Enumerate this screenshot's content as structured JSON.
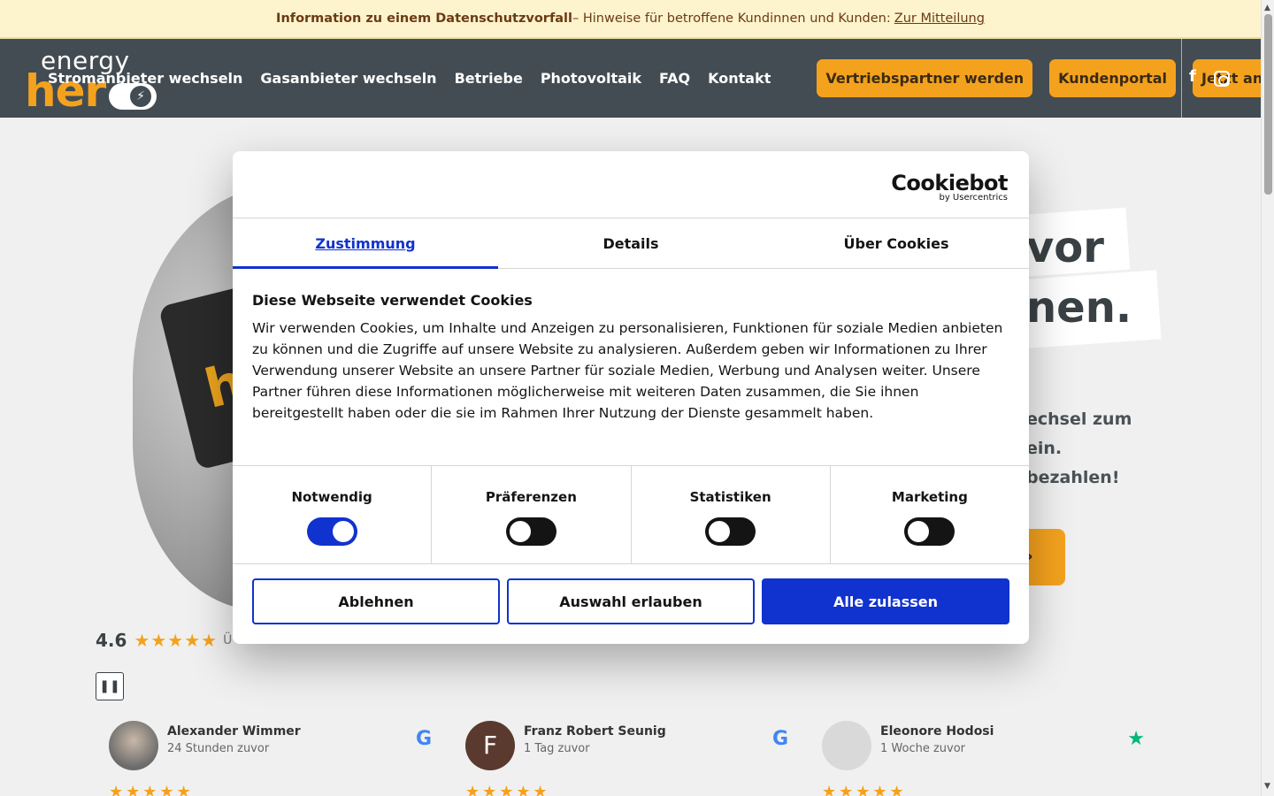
{
  "notice": {
    "bold": "Information zu einem Datenschutzvorfall",
    "text": " – Hinweise für betroffene Kundinnen und Kunden: ",
    "link": "Zur Mitteilung"
  },
  "logo": {
    "line1": "energy",
    "line2": "her",
    "icon": "lightning-icon",
    "glyph": "⚡"
  },
  "nav": {
    "links": [
      "Stromanbieter wechseln",
      "Gasanbieter wechseln",
      "Betriebe",
      "Photovoltaik",
      "FAQ",
      "Kontakt"
    ],
    "buttons": [
      "Vertriebspartner werden",
      "Kundenportal",
      "Jetzt anmelden!"
    ],
    "social": {
      "facebook": "f",
      "facebook_icon": "facebook-icon",
      "instagram_icon": "instagram-icon"
    }
  },
  "hero": {
    "title1": "vor",
    "title2": "nen.",
    "sub1": "echsel zum",
    "sub2": "ein.",
    "sub3": "bezahlen!",
    "cta_arrow": "›",
    "bulb_letter": "h"
  },
  "rating": {
    "value": "4.6",
    "stars": "★★★★★",
    "label": "Ü"
  },
  "pause": "❚❚",
  "reviews": [
    {
      "name": "Alexander Wimmer",
      "time": "24 Stunden zuvor",
      "source": "G",
      "stars": "★★★★★"
    },
    {
      "name": "Franz Robert Seunig",
      "time": "1 Tag zuvor",
      "source": "G",
      "initial": "F",
      "stars": "★★★★★"
    },
    {
      "name": "Eleonore Hodosi",
      "time": "1 Woche zuvor",
      "source": "★",
      "stars": "★★★★★"
    }
  ],
  "dialog": {
    "brand": "Cookiebot",
    "brand_by": "by Usercentrics",
    "tabs": [
      "Zustimmung",
      "Details",
      "Über Cookies"
    ],
    "title": "Diese Webseite verwendet Cookies",
    "text": "Wir verwenden Cookies, um Inhalte und Anzeigen zu personalisieren, Funktionen für soziale Medien anbieten zu können und die Zugriffe auf unsere Website zu analysieren. Außerdem geben wir Informationen zu Ihrer Verwendung unserer Website an unsere Partner für soziale Medien, Werbung und Analysen weiter. Unsere Partner führen diese Informationen möglicherweise mit weiteren Daten zusammen, die Sie ihnen bereitgestellt haben oder die sie im Rahmen Ihrer Nutzung der Dienste gesammelt haben.",
    "toggles": [
      {
        "label": "Notwendig",
        "on": true
      },
      {
        "label": "Präferenzen",
        "on": false
      },
      {
        "label": "Statistiken",
        "on": false
      },
      {
        "label": "Marketing",
        "on": false
      }
    ],
    "buttons": {
      "deny": "Ablehnen",
      "selection": "Auswahl erlauben",
      "all": "Alle zulassen"
    }
  },
  "colors": {
    "accent": "#f4a21e",
    "header": "#434c52",
    "cookiebot_blue": "#1032cf",
    "notice_bg": "#fdf3cd"
  }
}
